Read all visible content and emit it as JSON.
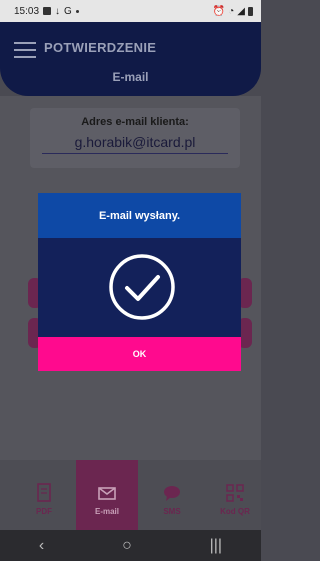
{
  "status_bar": {
    "time": "15:03",
    "left_icons": [
      "gallery-icon",
      "download-icon",
      "google-icon"
    ],
    "right_icons": [
      "alarm-icon",
      "wifi-icon",
      "signal-icon",
      "battery-icon"
    ]
  },
  "header": {
    "title": "POTWIERDZENIE",
    "subtitle": "E-mail"
  },
  "email_card": {
    "label": "Adres e-mail klienta:",
    "value": "g.horabik@itcard.pl"
  },
  "tabs": [
    {
      "label": "PDF",
      "icon": "pdf-icon",
      "active": false
    },
    {
      "label": "E-mail",
      "icon": "envelope-icon",
      "active": true
    },
    {
      "label": "SMS",
      "icon": "chat-icon",
      "active": false
    },
    {
      "label": "Kod QR",
      "icon": "qr-code-icon",
      "active": false
    }
  ],
  "modal": {
    "title": "E-mail wysłany.",
    "icon": "check-circle-icon",
    "button_label": "OK"
  },
  "nav_bar": {
    "back": "‹",
    "home": "○",
    "recents": "|||"
  },
  "colors": {
    "header_bg": "#101a47",
    "modal_bg": "#13215a",
    "modal_header": "#0e49a6",
    "accent": "#ff0a8e"
  }
}
